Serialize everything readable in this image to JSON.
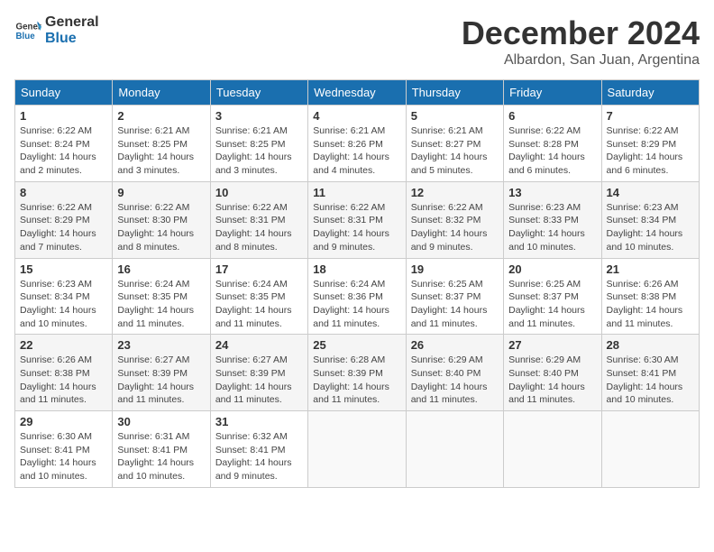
{
  "header": {
    "logo_general": "General",
    "logo_blue": "Blue",
    "month_title": "December 2024",
    "location": "Albardon, San Juan, Argentina"
  },
  "weekdays": [
    "Sunday",
    "Monday",
    "Tuesday",
    "Wednesday",
    "Thursday",
    "Friday",
    "Saturday"
  ],
  "weeks": [
    [
      {
        "day": "1",
        "sunrise": "Sunrise: 6:22 AM",
        "sunset": "Sunset: 8:24 PM",
        "daylight": "Daylight: 14 hours and 2 minutes."
      },
      {
        "day": "2",
        "sunrise": "Sunrise: 6:21 AM",
        "sunset": "Sunset: 8:25 PM",
        "daylight": "Daylight: 14 hours and 3 minutes."
      },
      {
        "day": "3",
        "sunrise": "Sunrise: 6:21 AM",
        "sunset": "Sunset: 8:25 PM",
        "daylight": "Daylight: 14 hours and 3 minutes."
      },
      {
        "day": "4",
        "sunrise": "Sunrise: 6:21 AM",
        "sunset": "Sunset: 8:26 PM",
        "daylight": "Daylight: 14 hours and 4 minutes."
      },
      {
        "day": "5",
        "sunrise": "Sunrise: 6:21 AM",
        "sunset": "Sunset: 8:27 PM",
        "daylight": "Daylight: 14 hours and 5 minutes."
      },
      {
        "day": "6",
        "sunrise": "Sunrise: 6:22 AM",
        "sunset": "Sunset: 8:28 PM",
        "daylight": "Daylight: 14 hours and 6 minutes."
      },
      {
        "day": "7",
        "sunrise": "Sunrise: 6:22 AM",
        "sunset": "Sunset: 8:29 PM",
        "daylight": "Daylight: 14 hours and 6 minutes."
      }
    ],
    [
      {
        "day": "8",
        "sunrise": "Sunrise: 6:22 AM",
        "sunset": "Sunset: 8:29 PM",
        "daylight": "Daylight: 14 hours and 7 minutes."
      },
      {
        "day": "9",
        "sunrise": "Sunrise: 6:22 AM",
        "sunset": "Sunset: 8:30 PM",
        "daylight": "Daylight: 14 hours and 8 minutes."
      },
      {
        "day": "10",
        "sunrise": "Sunrise: 6:22 AM",
        "sunset": "Sunset: 8:31 PM",
        "daylight": "Daylight: 14 hours and 8 minutes."
      },
      {
        "day": "11",
        "sunrise": "Sunrise: 6:22 AM",
        "sunset": "Sunset: 8:31 PM",
        "daylight": "Daylight: 14 hours and 9 minutes."
      },
      {
        "day": "12",
        "sunrise": "Sunrise: 6:22 AM",
        "sunset": "Sunset: 8:32 PM",
        "daylight": "Daylight: 14 hours and 9 minutes."
      },
      {
        "day": "13",
        "sunrise": "Sunrise: 6:23 AM",
        "sunset": "Sunset: 8:33 PM",
        "daylight": "Daylight: 14 hours and 10 minutes."
      },
      {
        "day": "14",
        "sunrise": "Sunrise: 6:23 AM",
        "sunset": "Sunset: 8:34 PM",
        "daylight": "Daylight: 14 hours and 10 minutes."
      }
    ],
    [
      {
        "day": "15",
        "sunrise": "Sunrise: 6:23 AM",
        "sunset": "Sunset: 8:34 PM",
        "daylight": "Daylight: 14 hours and 10 minutes."
      },
      {
        "day": "16",
        "sunrise": "Sunrise: 6:24 AM",
        "sunset": "Sunset: 8:35 PM",
        "daylight": "Daylight: 14 hours and 11 minutes."
      },
      {
        "day": "17",
        "sunrise": "Sunrise: 6:24 AM",
        "sunset": "Sunset: 8:35 PM",
        "daylight": "Daylight: 14 hours and 11 minutes."
      },
      {
        "day": "18",
        "sunrise": "Sunrise: 6:24 AM",
        "sunset": "Sunset: 8:36 PM",
        "daylight": "Daylight: 14 hours and 11 minutes."
      },
      {
        "day": "19",
        "sunrise": "Sunrise: 6:25 AM",
        "sunset": "Sunset: 8:37 PM",
        "daylight": "Daylight: 14 hours and 11 minutes."
      },
      {
        "day": "20",
        "sunrise": "Sunrise: 6:25 AM",
        "sunset": "Sunset: 8:37 PM",
        "daylight": "Daylight: 14 hours and 11 minutes."
      },
      {
        "day": "21",
        "sunrise": "Sunrise: 6:26 AM",
        "sunset": "Sunset: 8:38 PM",
        "daylight": "Daylight: 14 hours and 11 minutes."
      }
    ],
    [
      {
        "day": "22",
        "sunrise": "Sunrise: 6:26 AM",
        "sunset": "Sunset: 8:38 PM",
        "daylight": "Daylight: 14 hours and 11 minutes."
      },
      {
        "day": "23",
        "sunrise": "Sunrise: 6:27 AM",
        "sunset": "Sunset: 8:39 PM",
        "daylight": "Daylight: 14 hours and 11 minutes."
      },
      {
        "day": "24",
        "sunrise": "Sunrise: 6:27 AM",
        "sunset": "Sunset: 8:39 PM",
        "daylight": "Daylight: 14 hours and 11 minutes."
      },
      {
        "day": "25",
        "sunrise": "Sunrise: 6:28 AM",
        "sunset": "Sunset: 8:39 PM",
        "daylight": "Daylight: 14 hours and 11 minutes."
      },
      {
        "day": "26",
        "sunrise": "Sunrise: 6:29 AM",
        "sunset": "Sunset: 8:40 PM",
        "daylight": "Daylight: 14 hours and 11 minutes."
      },
      {
        "day": "27",
        "sunrise": "Sunrise: 6:29 AM",
        "sunset": "Sunset: 8:40 PM",
        "daylight": "Daylight: 14 hours and 11 minutes."
      },
      {
        "day": "28",
        "sunrise": "Sunrise: 6:30 AM",
        "sunset": "Sunset: 8:41 PM",
        "daylight": "Daylight: 14 hours and 10 minutes."
      }
    ],
    [
      {
        "day": "29",
        "sunrise": "Sunrise: 6:30 AM",
        "sunset": "Sunset: 8:41 PM",
        "daylight": "Daylight: 14 hours and 10 minutes."
      },
      {
        "day": "30",
        "sunrise": "Sunrise: 6:31 AM",
        "sunset": "Sunset: 8:41 PM",
        "daylight": "Daylight: 14 hours and 10 minutes."
      },
      {
        "day": "31",
        "sunrise": "Sunrise: 6:32 AM",
        "sunset": "Sunset: 8:41 PM",
        "daylight": "Daylight: 14 hours and 9 minutes."
      },
      null,
      null,
      null,
      null
    ]
  ]
}
